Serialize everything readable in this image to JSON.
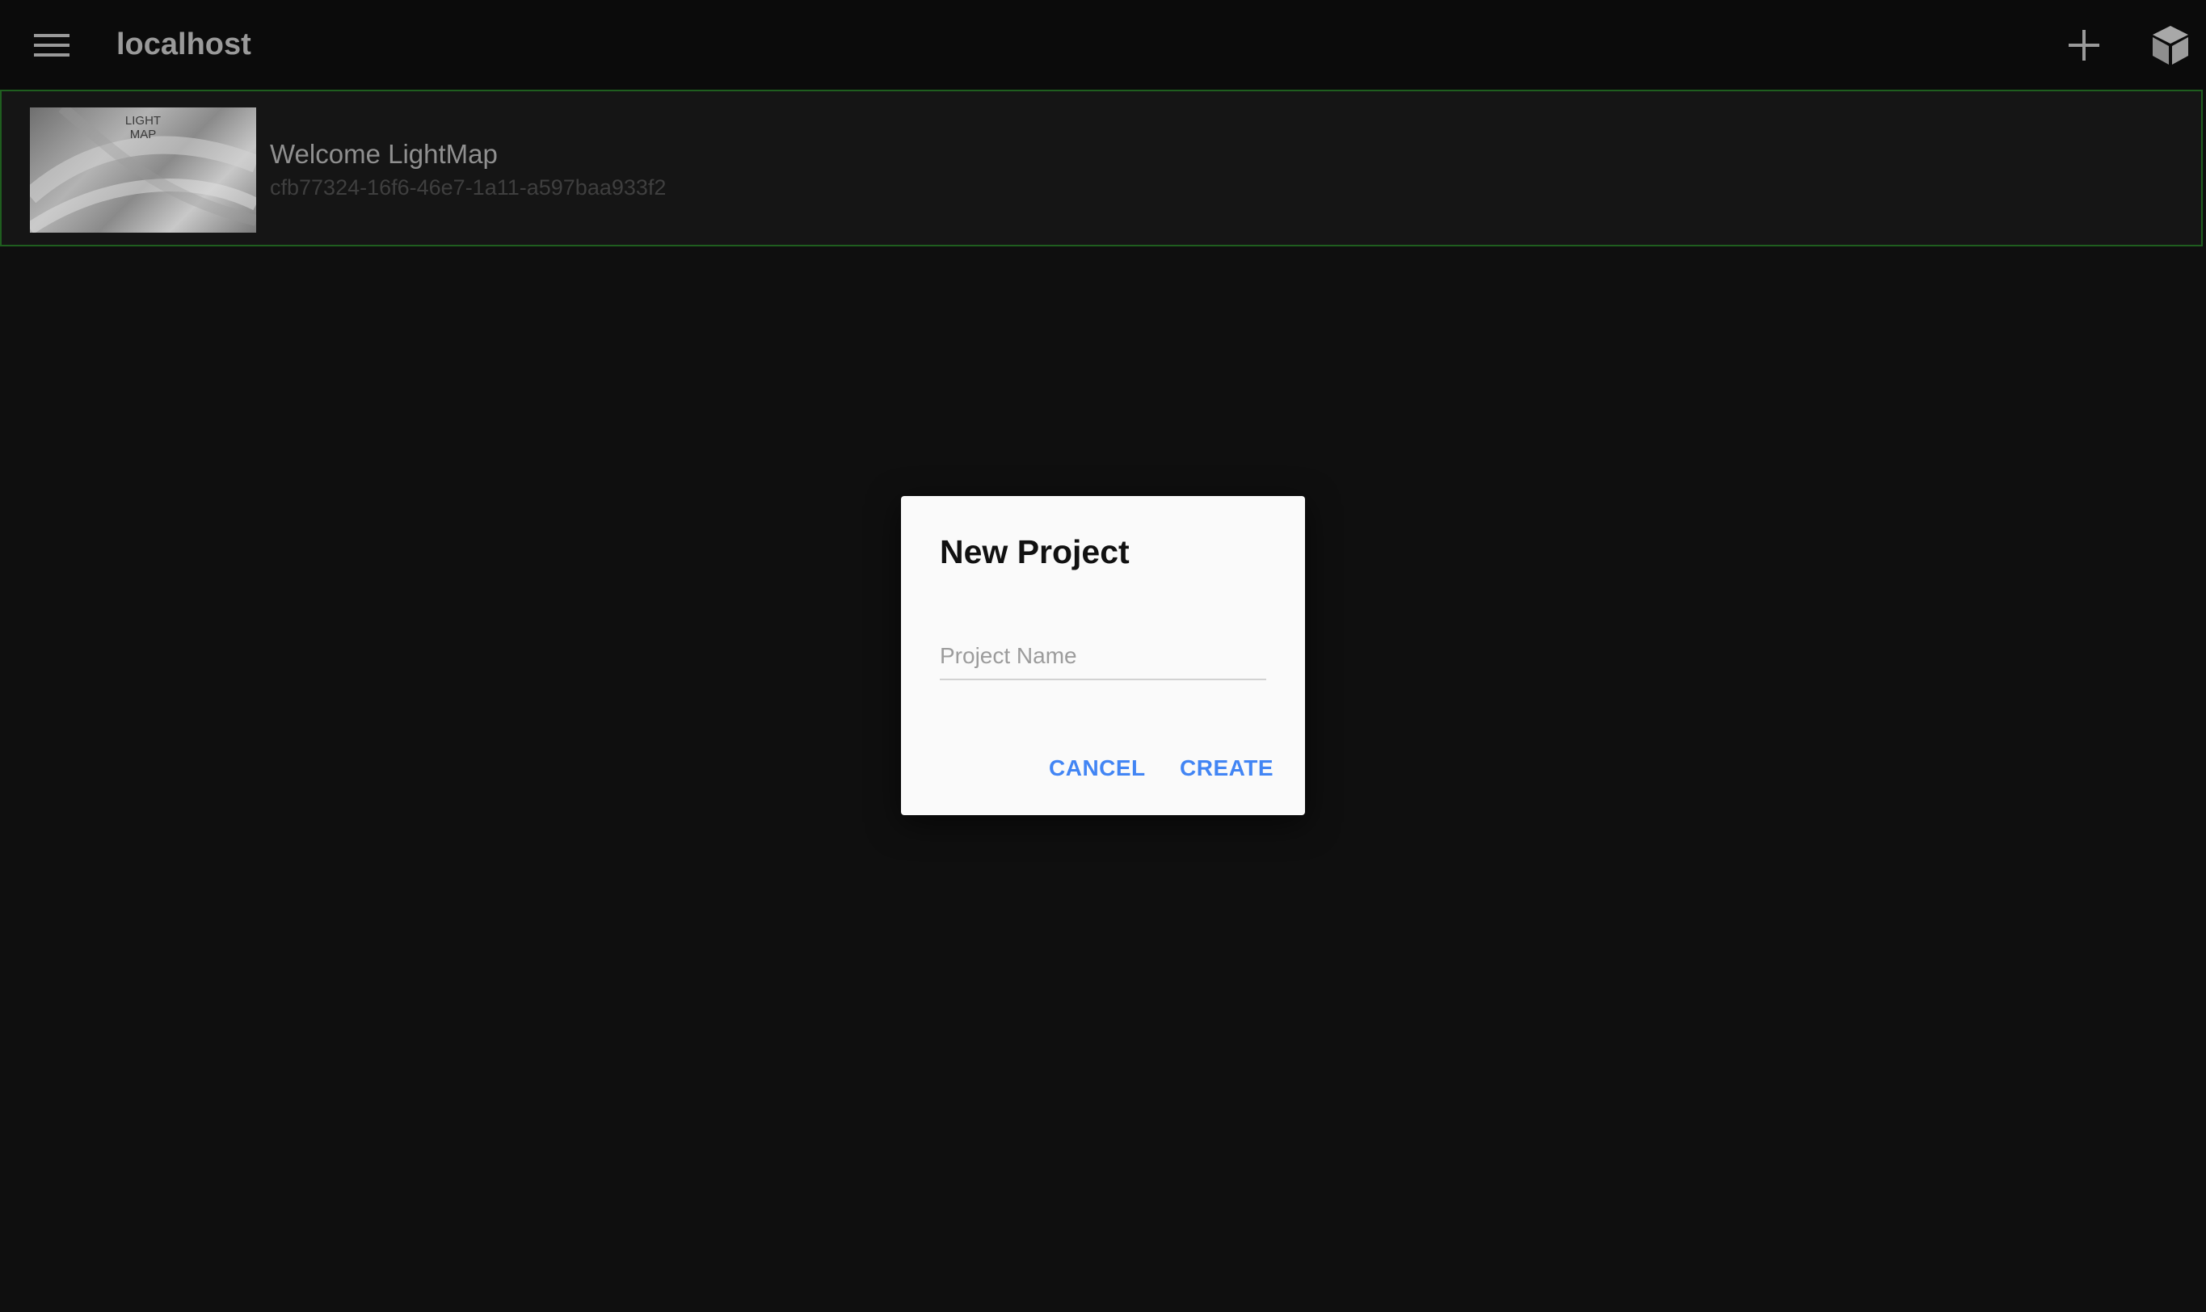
{
  "header": {
    "title": "localhost",
    "menu_icon": "menu-icon",
    "add_icon": "add-icon",
    "cube_icon": "cube-icon"
  },
  "projects": [
    {
      "name": "Welcome LightMap",
      "id": "cfb77324-16f6-46e7-1a11-a597baa933f2",
      "thumbnail_label": "LIGHT\nMAP",
      "selected": true
    }
  ],
  "dialog": {
    "title": "New Project",
    "input_placeholder": "Project Name",
    "input_value": "",
    "cancel_label": "CANCEL",
    "create_label": "CREATE"
  },
  "colors": {
    "background": "#0f0f0f",
    "selected_border": "#1f5e1f",
    "accent": "#4285f4"
  }
}
